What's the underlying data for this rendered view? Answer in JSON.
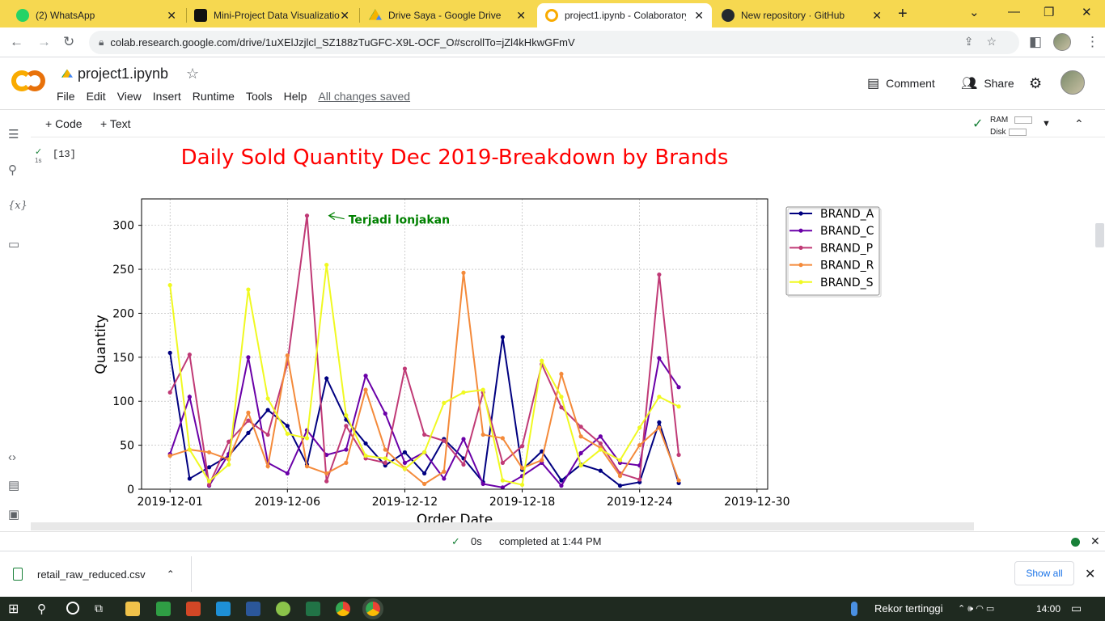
{
  "browser": {
    "tabs": [
      {
        "label": "(2) WhatsApp",
        "color": "#25d366"
      },
      {
        "label": "Mini-Project Data Visualizatio",
        "color": "#111111"
      },
      {
        "label": "Drive Saya - Google Drive",
        "color": "#4285f4"
      },
      {
        "label": "project1.ipynb - Colaboratory",
        "color": "#f9ab00"
      },
      {
        "label": "New repository · GitHub",
        "color": "#24292f"
      }
    ],
    "url": "colab.research.google.com/drive/1uXElJzjlcl_SZ188zTuGFC-X9L-OCF_O#scrollTo=jZl4kHkwGFmV"
  },
  "colab": {
    "title": "project1.ipynb",
    "menu": [
      "File",
      "Edit",
      "View",
      "Insert",
      "Runtime",
      "Tools",
      "Help"
    ],
    "saved_status": "All changes saved",
    "comment_label": "Comment",
    "share_label": "Share",
    "add_code": "+ Code",
    "add_text": "+ Text",
    "ram_label": "RAM",
    "disk_label": "Disk",
    "cell_time": "1s",
    "cell_number": "[13]"
  },
  "chart_data": {
    "type": "line",
    "title": "Daily Sold Quantity Dec 2019-Breakdown by Brands",
    "xlabel": "Order Date",
    "ylabel": "Quantity",
    "ylim": [
      0,
      330
    ],
    "yticks": [
      0,
      50,
      100,
      150,
      200,
      250,
      300
    ],
    "xticks": [
      "2019-12-01",
      "2019-12-06",
      "2019-12-12",
      "2019-12-18",
      "2019-12-24",
      "2019-12-30"
    ],
    "xtick_days": [
      1,
      7,
      13,
      19,
      25,
      31
    ],
    "grid": true,
    "legend": "right, outside",
    "annotation": {
      "text": "Terjadi lonjakan",
      "x_day": 9,
      "y": 311,
      "color": "#008000"
    },
    "x_days": [
      1,
      2,
      3,
      4,
      5,
      6,
      7,
      8,
      9,
      10,
      11,
      12,
      13,
      14,
      15,
      16,
      17,
      18,
      19,
      20,
      21,
      22,
      23,
      24,
      25,
      26,
      27,
      28,
      29,
      30,
      31
    ],
    "series": [
      {
        "name": "BRAND_A",
        "color": "#000080",
        "values": [
          155,
          12,
          25,
          38,
          64,
          90,
          72,
          28,
          126,
          79,
          52,
          27,
          42,
          18,
          57,
          35,
          8,
          173,
          22,
          43,
          10,
          28,
          21,
          4,
          8,
          76,
          7
        ]
      },
      {
        "name": "BRAND_C",
        "color": "#6a00a8",
        "values": [
          40,
          105,
          4,
          40,
          150,
          30,
          18,
          67,
          39,
          45,
          129,
          86,
          30,
          42,
          12,
          57,
          6,
          2,
          15,
          30,
          4,
          41,
          60,
          30,
          27,
          149,
          116
        ]
      },
      {
        "name": "BRAND_P",
        "color": "#c03a76",
        "values": [
          110,
          153,
          5,
          54,
          78,
          62,
          143,
          311,
          9,
          72,
          35,
          30,
          137,
          62,
          55,
          28,
          110,
          30,
          49,
          142,
          93,
          71,
          52,
          18,
          11,
          244,
          39
        ]
      },
      {
        "name": "BRAND_R",
        "color": "#f48a3a",
        "values": [
          38,
          45,
          42,
          34,
          87,
          26,
          152,
          26,
          18,
          30,
          113,
          45,
          24,
          6,
          20,
          246,
          62,
          58,
          24,
          33,
          131,
          60,
          47,
          15,
          50,
          70,
          10
        ]
      },
      {
        "name": "BRAND_S",
        "color": "#f0f921",
        "values": [
          232,
          45,
          9,
          28,
          227,
          103,
          63,
          58,
          255,
          84,
          38,
          35,
          23,
          42,
          98,
          110,
          113,
          10,
          5,
          146,
          105,
          27,
          45,
          33,
          70,
          105,
          94
        ]
      }
    ]
  },
  "status": {
    "time": "0s",
    "completed": "completed at 1:44 PM"
  },
  "downloads": {
    "file": "retail_raw_reduced.csv",
    "show_all": "Show all"
  },
  "taskbar": {
    "weather": "Rekor tertinggi",
    "clock": "14:00"
  }
}
